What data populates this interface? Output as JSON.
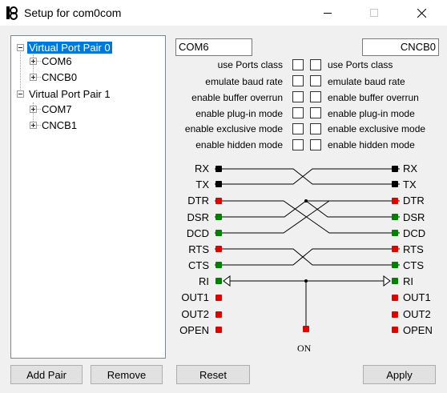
{
  "window": {
    "title": "Setup for com0com",
    "icons": {
      "app": "com0com-app-icon",
      "minimize": "minimize-icon",
      "maximize": "maximize-icon",
      "close": "close-icon"
    }
  },
  "tree": {
    "pairs": [
      {
        "label": "Virtual Port Pair 0",
        "selected": true,
        "children": [
          "COM6",
          "CNCB0"
        ]
      },
      {
        "label": "Virtual Port Pair 1",
        "selected": false,
        "children": [
          "COM7",
          "CNCB1"
        ]
      }
    ]
  },
  "ports": {
    "left_name": "COM6",
    "right_name": "CNCB0"
  },
  "options": {
    "left": [
      "use Ports class",
      "emulate baud rate",
      "enable buffer overrun",
      "enable plug-in mode",
      "enable exclusive mode",
      "enable hidden mode"
    ],
    "right": [
      "use Ports class",
      "emulate baud rate",
      "enable buffer overrun",
      "enable plug-in mode",
      "enable exclusive mode",
      "enable hidden mode"
    ]
  },
  "wiring": {
    "pins_left": [
      "RX",
      "TX",
      "DTR",
      "DSR",
      "DCD",
      "RTS",
      "CTS",
      "RI",
      "OUT1",
      "OUT2",
      "OPEN"
    ],
    "pins_right": [
      "RX",
      "TX",
      "DTR",
      "DSR",
      "DCD",
      "RTS",
      "CTS",
      "RI",
      "OUT1",
      "OUT2",
      "OPEN"
    ],
    "on_label": "ON",
    "colors": {
      "black": "#000000",
      "red": "#e00000",
      "green": "#008000"
    }
  },
  "buttons": {
    "add_pair": "Add Pair",
    "remove": "Remove",
    "reset": "Reset",
    "apply": "Apply"
  }
}
